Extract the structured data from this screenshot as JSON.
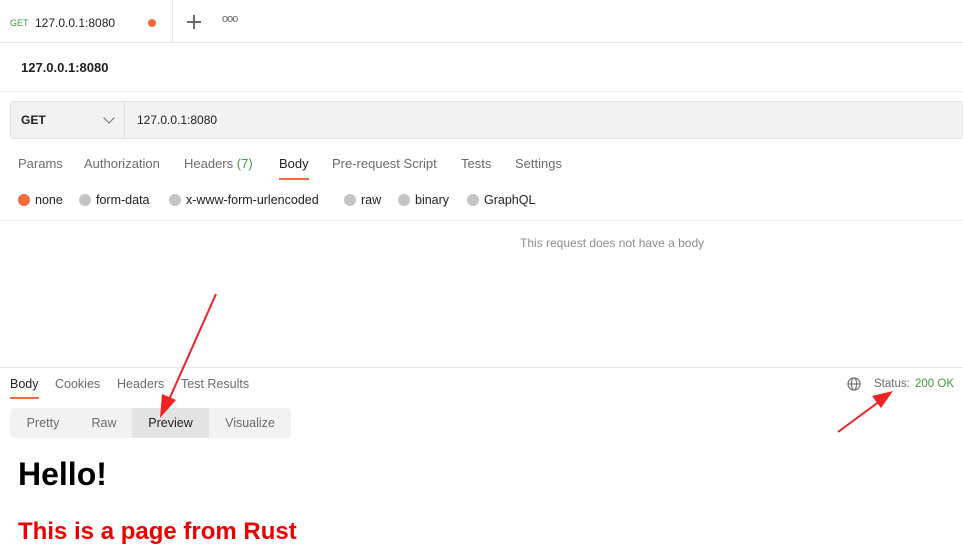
{
  "tab": {
    "method": "GET",
    "title": "127.0.0.1:8080"
  },
  "request": {
    "name": "127.0.0.1:8080",
    "method": "GET",
    "url": "127.0.0.1:8080",
    "tabs": [
      {
        "label": "Params"
      },
      {
        "label": "Authorization"
      },
      {
        "label": "Headers",
        "count": "(7)"
      },
      {
        "label": "Body"
      },
      {
        "label": "Pre-request Script"
      },
      {
        "label": "Tests"
      },
      {
        "label": "Settings"
      }
    ],
    "active_tab": "Body",
    "body_types": [
      "none",
      "form-data",
      "x-www-form-urlencoded",
      "raw",
      "binary",
      "GraphQL"
    ],
    "selected_body_type": "none",
    "empty_message": "This request does not have a body"
  },
  "response": {
    "tabs": [
      "Body",
      "Cookies",
      "Headers",
      "Test Results"
    ],
    "active_tab": "Body",
    "status_label": "Status:",
    "status_value": "200 OK",
    "views": [
      "Pretty",
      "Raw",
      "Preview",
      "Visualize"
    ],
    "active_view": "Preview",
    "preview": {
      "heading": "Hello!",
      "subheading": "This is a page from Rust"
    }
  },
  "colors": {
    "accent": "#f26b3a",
    "success": "#3c9a3c",
    "annotation_arrow": "#ee2222",
    "preview_red": "#ee0000"
  },
  "icons": [
    "plus-icon",
    "more-icon",
    "chevron-down-icon",
    "globe-icon"
  ]
}
